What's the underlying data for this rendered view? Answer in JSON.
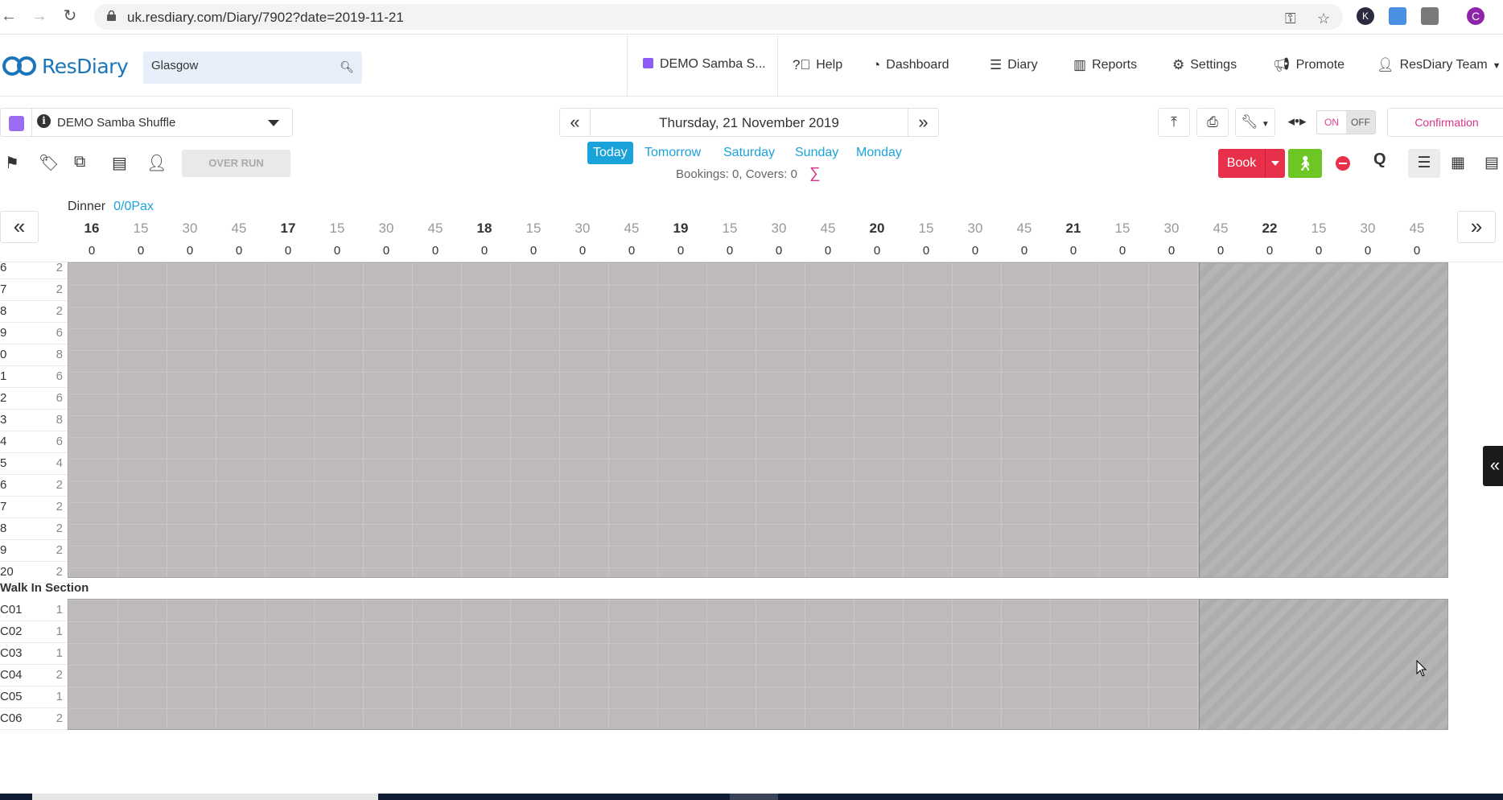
{
  "browser": {
    "url": "uk.resdiary.com/Diary/7902?date=2019-11-21",
    "profile_initial": "C",
    "ext_initial": "K"
  },
  "header": {
    "logo_text": "ResDiary",
    "search_value": "Glasgow",
    "venue_short": "DEMO Samba S...",
    "nav": {
      "help": "Help",
      "dashboard": "Dashboard",
      "diary": "Diary",
      "reports": "Reports",
      "settings": "Settings",
      "promote": "Promote",
      "user": "ResDiary Team"
    }
  },
  "toolbar": {
    "venue": "DEMO Samba Shuffle",
    "overrun": "OVER RUN",
    "date": "Thursday, 21 November 2019",
    "quick_days": [
      "Today",
      "Tomorrow",
      "Saturday",
      "Sunday",
      "Monday"
    ],
    "counts": "Bookings: 0, Covers: 0",
    "on": "ON",
    "off": "OFF",
    "confirmation": "Confirmation",
    "book": "Book",
    "q": "Q"
  },
  "timeline": {
    "service": "Dinner",
    "pax": "0/0Pax",
    "times": [
      "16",
      "15",
      "30",
      "45",
      "17",
      "15",
      "30",
      "45",
      "18",
      "15",
      "30",
      "45",
      "19",
      "15",
      "30",
      "45",
      "20",
      "15",
      "30",
      "45",
      "21",
      "15",
      "30",
      "45",
      "22",
      "15",
      "30",
      "45"
    ],
    "counts": [
      "0",
      "0",
      "0",
      "0",
      "0",
      "0",
      "0",
      "0",
      "0",
      "0",
      "0",
      "0",
      "0",
      "0",
      "0",
      "0",
      "0",
      "0",
      "0",
      "0",
      "0",
      "0",
      "0",
      "0",
      "0",
      "0",
      "0",
      "0"
    ]
  },
  "tables_main": [
    {
      "name": "6",
      "cap": "2"
    },
    {
      "name": "7",
      "cap": "2"
    },
    {
      "name": "8",
      "cap": "2"
    },
    {
      "name": "9",
      "cap": "6"
    },
    {
      "name": "0",
      "cap": "8"
    },
    {
      "name": "1",
      "cap": "6"
    },
    {
      "name": "2",
      "cap": "6"
    },
    {
      "name": "3",
      "cap": "8"
    },
    {
      "name": "4",
      "cap": "6"
    },
    {
      "name": "5",
      "cap": "4"
    },
    {
      "name": "6",
      "cap": "2"
    },
    {
      "name": "7",
      "cap": "2"
    },
    {
      "name": "8",
      "cap": "2"
    },
    {
      "name": "9",
      "cap": "2"
    },
    {
      "name": "20",
      "cap": "2"
    }
  ],
  "walk_in_section": {
    "title": "Walk In Section",
    "tables": [
      {
        "name": "C01",
        "cap": "1"
      },
      {
        "name": "C02",
        "cap": "1"
      },
      {
        "name": "C03",
        "cap": "1"
      },
      {
        "name": "C04",
        "cap": "2"
      },
      {
        "name": "C05",
        "cap": "1"
      },
      {
        "name": "C06",
        "cap": "2"
      }
    ]
  }
}
